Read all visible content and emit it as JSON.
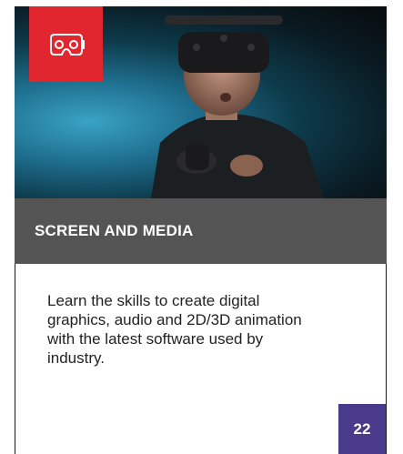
{
  "card": {
    "category_icon": "vr-headset-icon",
    "title": "SCREEN AND MEDIA",
    "description": "Learn the skills to create digital graphics, audio and 2D/3D animation with the latest software used by industry.",
    "page_number": "22"
  },
  "colors": {
    "badge": "#e2262f",
    "header_bar": "#545454",
    "page_badge": "#4a3a8c"
  }
}
